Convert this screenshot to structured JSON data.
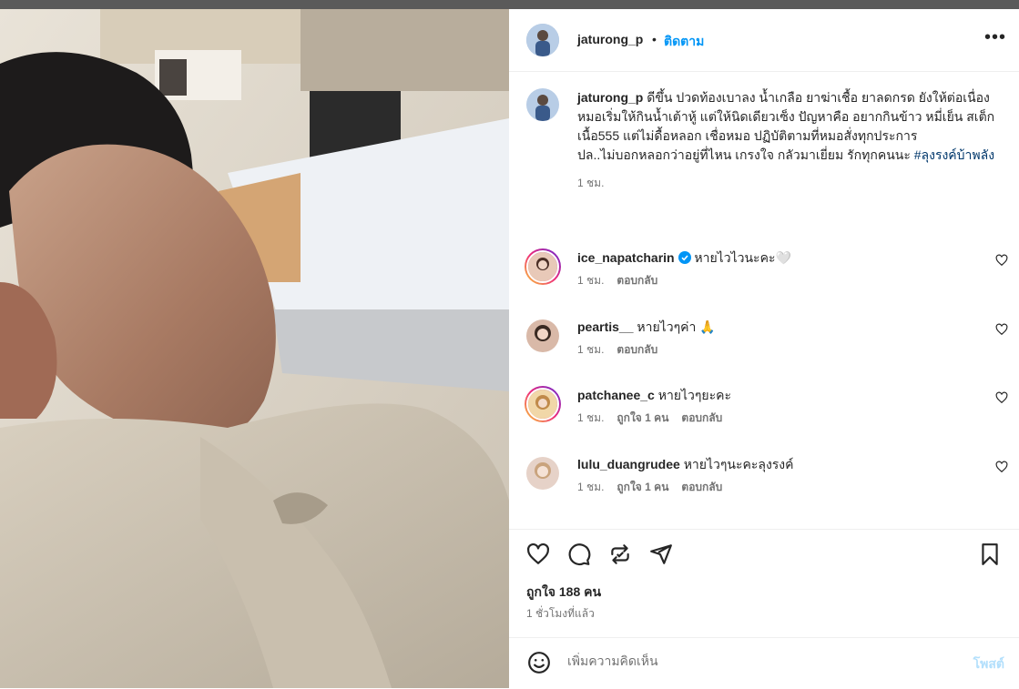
{
  "post": {
    "author": "jaturong_p",
    "follow_label": "ติดตาม",
    "separator": "•",
    "more_label": "•••"
  },
  "caption": {
    "author": "jaturong_p",
    "text": "ดีขึ้น ปวดท้องเบาลง น้ำเกลือ ยาฆ่าเชื้อ ยาลดกรด ยังให้ต่อเนื่อง หมอเริ่มให้กินน้ำเต้าหู้ แต่ให้นิดเดียวเซ็ง ปัญหาคือ อยากกินข้าว หมี่เย็น สเต็กเนื้อ555 แต่ไม่ดื้อหลอก เชื่อหมอ ปฏิบัติตามที่หมอสั่งทุกประการ",
    "ps": "ปล..ไม่บอกหลอกว่าอยู่ที่ไหน เกรงใจ กลัวมาเยี่ยม รักทุกคนนะ ",
    "hashtag": "#ลุงรงค์บ้าพลัง",
    "time": "1 ชม."
  },
  "comments": [
    {
      "user": "ice_napatcharin",
      "verified": true,
      "text": "หายไวไวนะคะ🤍",
      "time": "1 ชม.",
      "likes": "",
      "reply": "ตอบกลับ"
    },
    {
      "user": "peartis__",
      "verified": false,
      "text": "หายไวๆค่า 🙏",
      "time": "1 ชม.",
      "likes": "",
      "reply": "ตอบกลับ"
    },
    {
      "user": "patchanee_c",
      "verified": false,
      "text": "หายไวๆยะคะ",
      "time": "1 ชม.",
      "likes": "ถูกใจ 1 คน",
      "reply": "ตอบกลับ"
    },
    {
      "user": "lulu_duangrudee",
      "verified": false,
      "text": "หายไวๆนะคะลุงรงค์",
      "time": "1 ชม.",
      "likes": "ถูกใจ 1 คน",
      "reply": "ตอบกลับ"
    }
  ],
  "engagement": {
    "likes": "ถูกใจ 188 คน",
    "posted": "1 ชั่วโมงที่แล้ว"
  },
  "composer": {
    "placeholder": "เพิ่มความคิดเห็น",
    "post_label": "โพสต์"
  },
  "icons": [
    "heart-icon",
    "comment-icon",
    "repost-icon",
    "share-icon",
    "bookmark-icon",
    "emoji-icon",
    "verified-icon",
    "more-icon"
  ],
  "colors": {
    "link": "#0095f6",
    "hashtag": "#00376b",
    "muted": "#737373",
    "verified": "#0095f6"
  }
}
